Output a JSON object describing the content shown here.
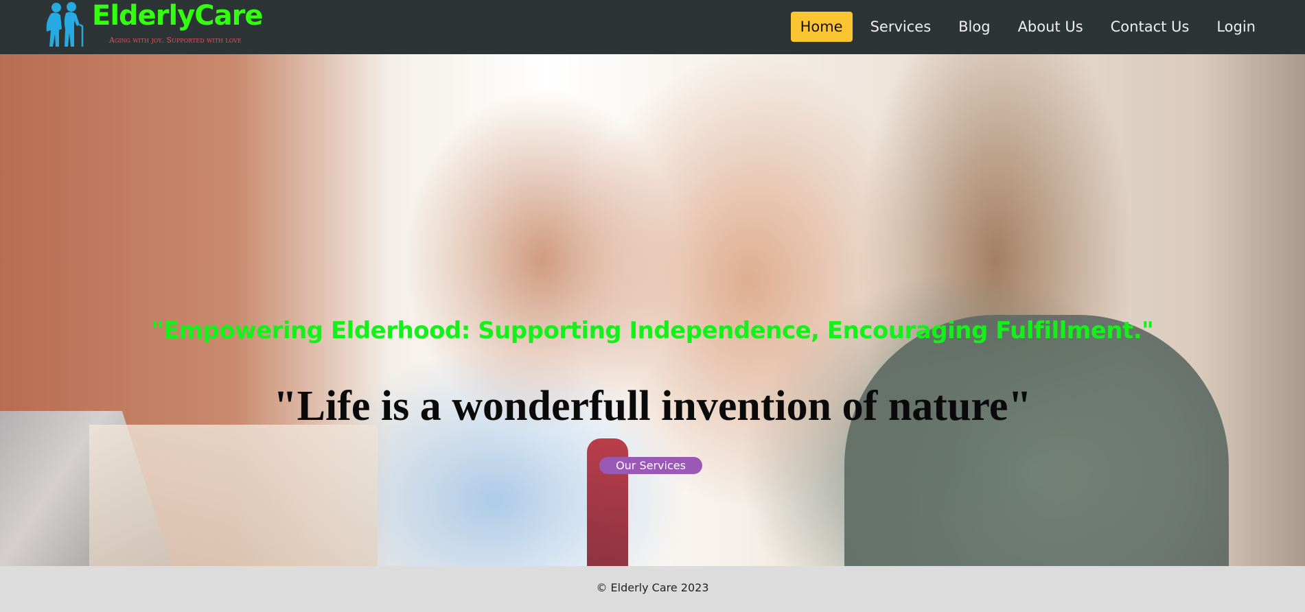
{
  "header": {
    "logo_title": "ElderlyCare",
    "logo_tagline": "Aging with joy. Supported with love",
    "logo_icon": "elderly-couple-icon",
    "nav": [
      {
        "label": "Home",
        "active": true
      },
      {
        "label": "Services",
        "active": false
      },
      {
        "label": "Blog",
        "active": false
      },
      {
        "label": "About Us",
        "active": false
      },
      {
        "label": "Contact Us",
        "active": false
      },
      {
        "label": "Login",
        "active": false
      }
    ]
  },
  "hero": {
    "slogan": "\"Empowering Elderhood: Supporting Independence, Encouraging Fulfillment.\"",
    "quote": "\"Life is a wonderfull invention of nature\"",
    "cta_label": "Our Services"
  },
  "footer": {
    "copyright": "© Elderly Care 2023"
  },
  "colors": {
    "header_bg": "#2d3436",
    "brand_green": "#33ff11",
    "tagline_red": "#e8505b",
    "nav_active_bg": "#fbc531",
    "cta_purple": "#9b59b6",
    "footer_bg": "#dcdcdc"
  }
}
